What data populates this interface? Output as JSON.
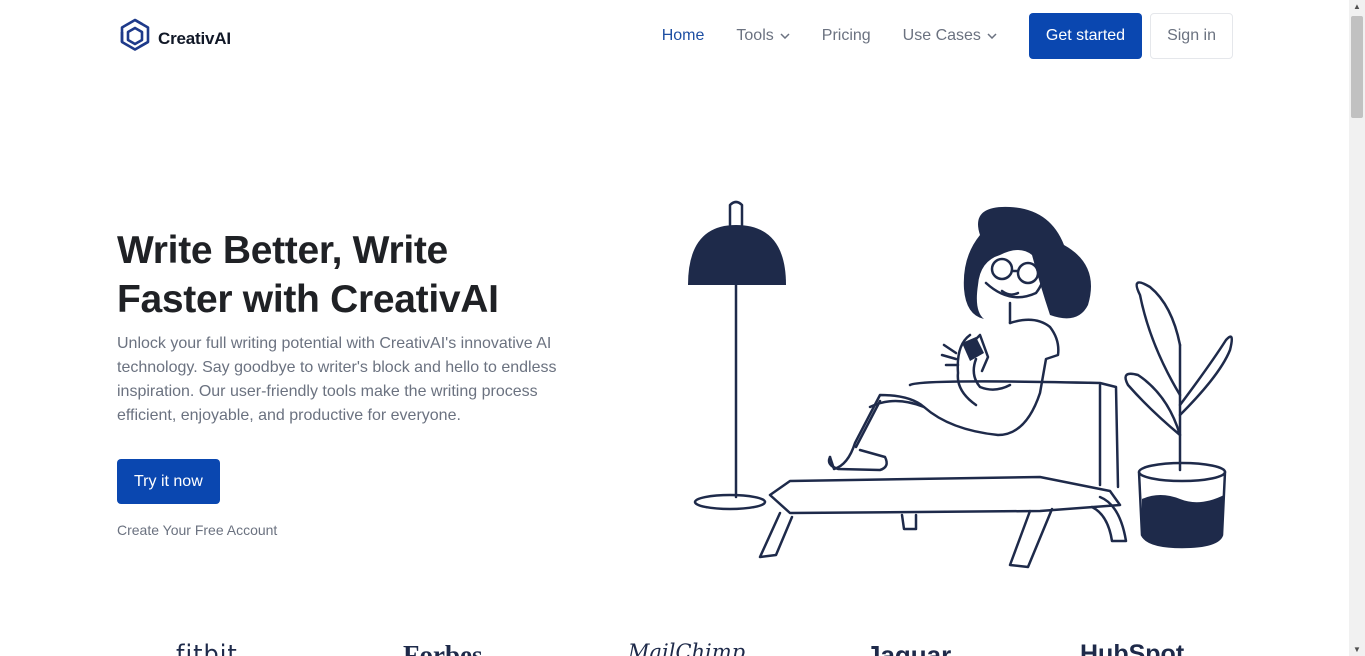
{
  "header": {
    "logo_text": "CreativAI",
    "nav": {
      "home": "Home",
      "tools": "Tools",
      "pricing": "Pricing",
      "use_cases": "Use Cases"
    },
    "get_started": "Get started",
    "sign_in": "Sign in"
  },
  "hero": {
    "title_line1": "Write Better, Write",
    "title_line2": "Faster with CreativAI",
    "description": "Unlock your full writing potential with CreativAI's innovative AI technology. Say goodbye to writer's block and hello to endless inspiration. Our user-friendly tools make the writing process efficient, enjoyable, and productive for everyone.",
    "cta": "Try it now",
    "cta_sub": "Create Your Free Account"
  },
  "brands": [
    "fitbit",
    "Forbes",
    "MailChimp",
    "Jaguar",
    "HubSpot"
  ],
  "colors": {
    "primary": "#0a47b0",
    "illustration": "#1e2a4a",
    "text_muted": "#6b7280"
  }
}
